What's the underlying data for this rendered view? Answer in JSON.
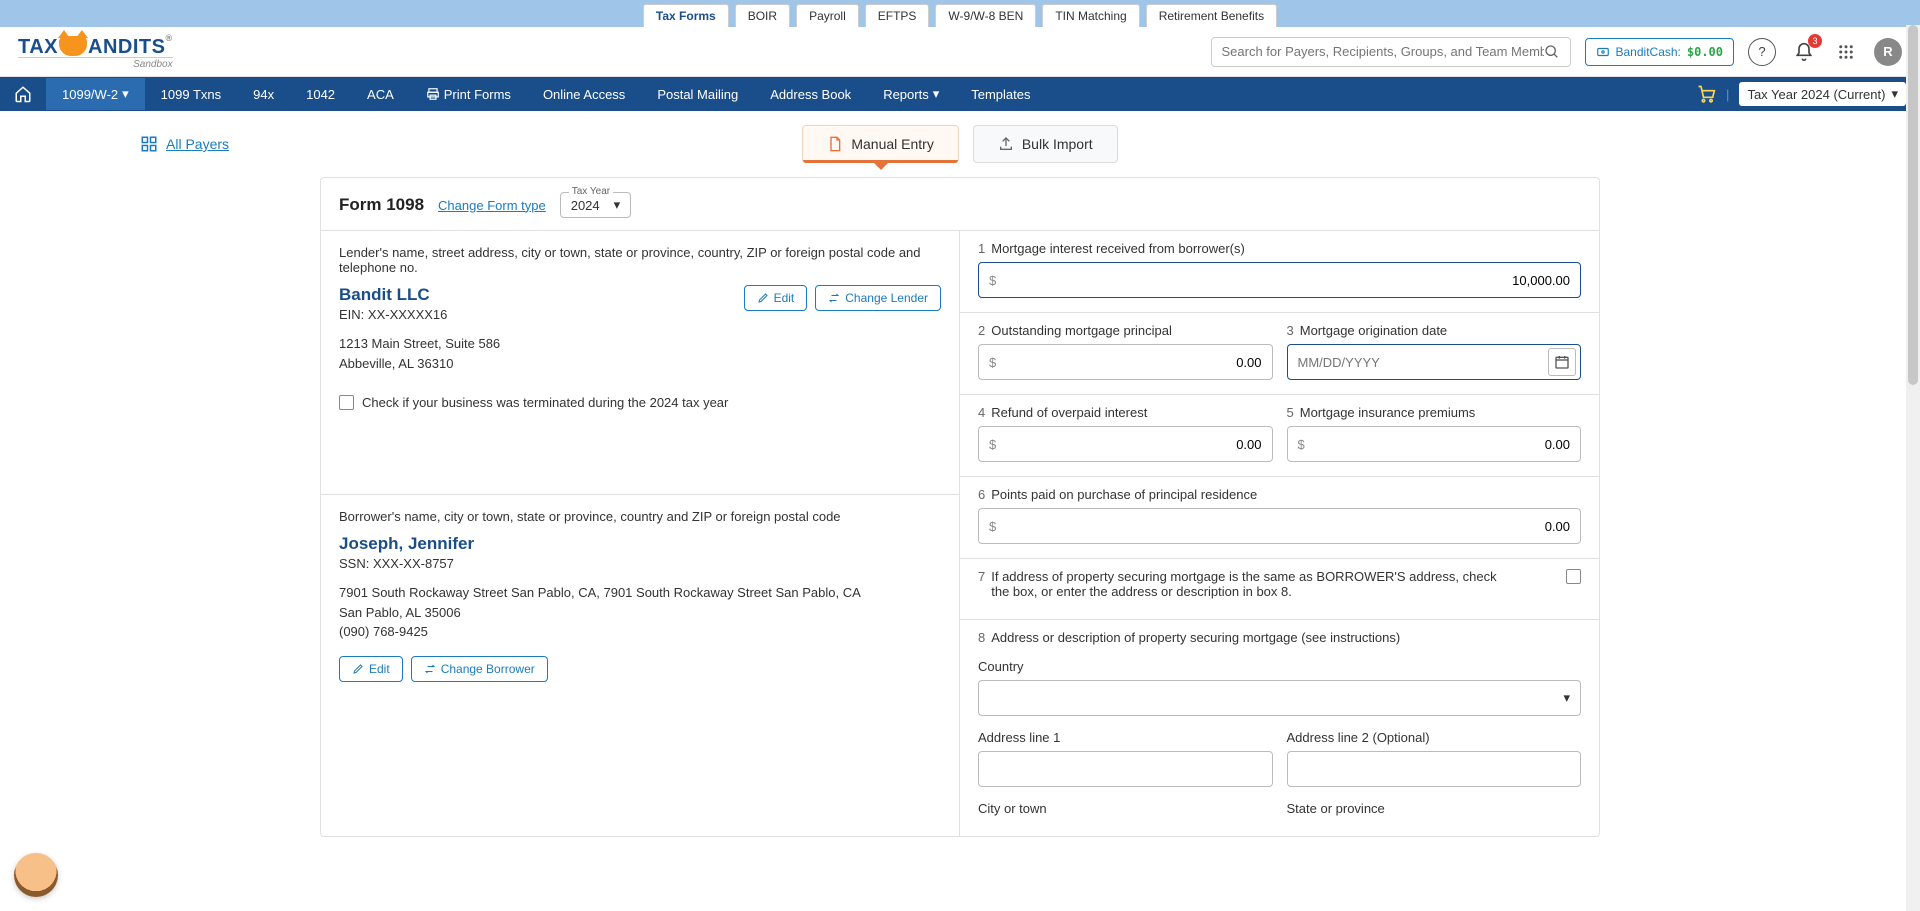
{
  "topTabs": [
    "Tax Forms",
    "BOIR",
    "Payroll",
    "EFTPS",
    "W-9/W-8 BEN",
    "TIN Matching",
    "Retirement Benefits"
  ],
  "topTabActive": 0,
  "logo": {
    "sandbox": "Sandbox"
  },
  "search": {
    "placeholder": "Search for Payers, Recipients, Groups, and Team Members"
  },
  "banditCash": {
    "label": "BanditCash:",
    "amount": "$0.00"
  },
  "notifCount": "3",
  "avatarLetter": "R",
  "nav": {
    "items": [
      "1099/W-2",
      "1099 Txns",
      "94x",
      "1042",
      "ACA",
      "Print Forms",
      "Online Access",
      "Postal Mailing",
      "Address Book",
      "Reports",
      "Templates"
    ],
    "printIcon": true,
    "activeIndex": 0,
    "taxYear": "Tax Year 2024 (Current)"
  },
  "allPayers": "All Payers",
  "entryTabs": {
    "manual": "Manual Entry",
    "bulk": "Bulk Import"
  },
  "formHeader": {
    "title": "Form 1098",
    "change": "Change Form type",
    "yearLabel": "Tax Year",
    "year": "2024"
  },
  "lender": {
    "sectionLabel": "Lender's name, street address, city or town, state or province, country, ZIP or foreign postal code and telephone no.",
    "name": "Bandit LLC",
    "ein": "EIN: XX-XXXXX16",
    "addr1": "1213 Main Street, Suite 586",
    "addr2": "Abbeville, AL 36310",
    "editBtn": "Edit",
    "changeBtn": "Change Lender",
    "terminateCheck": "Check if your business was terminated during the 2024 tax year"
  },
  "borrower": {
    "sectionLabel": "Borrower's name, city or town, state or province, country and ZIP or foreign postal code",
    "name": "Joseph, Jennifer",
    "ssn": "SSN: XXX-XX-8757",
    "addr1": "7901 South Rockaway Street San Pablo, CA, 7901 South Rockaway Street San Pablo, CA",
    "addr2": "San Pablo, AL 35006",
    "phone": "(090) 768-9425",
    "editBtn": "Edit",
    "changeBtn": "Change Borrower"
  },
  "boxes": {
    "b1": {
      "num": "1",
      "label": "Mortgage interest received from borrower(s)",
      "value": "10,000.00"
    },
    "b2": {
      "num": "2",
      "label": "Outstanding mortgage principal",
      "value": "0.00"
    },
    "b3": {
      "num": "3",
      "label": "Mortgage origination date",
      "placeholder": "MM/DD/YYYY"
    },
    "b4": {
      "num": "4",
      "label": "Refund of overpaid interest",
      "value": "0.00"
    },
    "b5": {
      "num": "5",
      "label": "Mortgage insurance premiums",
      "value": "0.00"
    },
    "b6": {
      "num": "6",
      "label": "Points paid on purchase of principal residence",
      "value": "0.00"
    },
    "b7": {
      "num": "7",
      "label": "If address of property securing mortgage is the same as BORROWER'S address, check the box, or enter the address or description in box 8."
    },
    "b8": {
      "num": "8",
      "label": "Address or description of property securing mortgage (see instructions)"
    }
  },
  "address": {
    "country": "Country",
    "line1": "Address line 1",
    "line2": "Address line 2 (Optional)",
    "city": "City or town",
    "state": "State or province"
  }
}
